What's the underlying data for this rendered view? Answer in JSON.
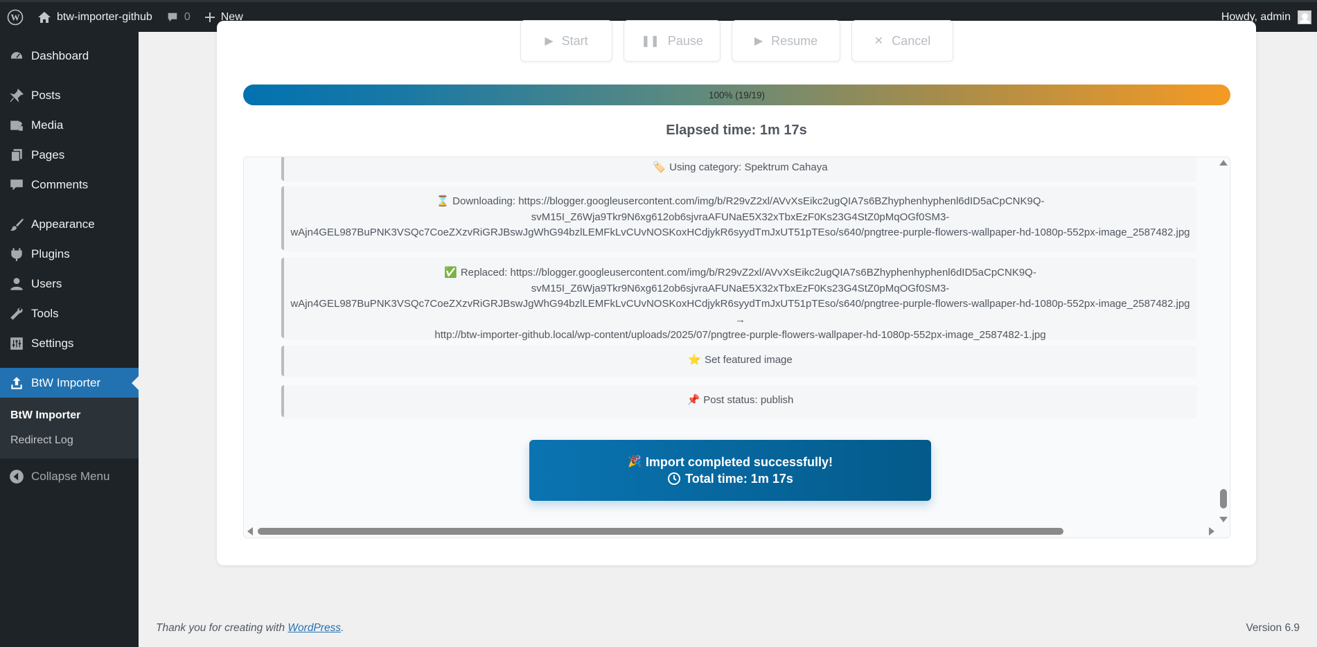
{
  "adminbar": {
    "site_name": "btw-importer-github",
    "comments_count": "0",
    "new_label": "New",
    "howdy": "Howdy, admin"
  },
  "sidebar": {
    "items": [
      {
        "label": "Dashboard",
        "icon": "dashboard-icon"
      },
      {
        "label": "Posts",
        "icon": "pushpin-icon"
      },
      {
        "label": "Media",
        "icon": "media-icon"
      },
      {
        "label": "Pages",
        "icon": "pages-icon"
      },
      {
        "label": "Comments",
        "icon": "comment-icon"
      },
      {
        "label": "Appearance",
        "icon": "paintbrush-icon"
      },
      {
        "label": "Plugins",
        "icon": "plugin-icon"
      },
      {
        "label": "Users",
        "icon": "user-icon"
      },
      {
        "label": "Tools",
        "icon": "wrench-icon"
      },
      {
        "label": "Settings",
        "icon": "settings-icon"
      },
      {
        "label": "BtW Importer",
        "icon": "upload-icon"
      }
    ],
    "submenu": [
      "BtW Importer",
      "Redirect Log"
    ],
    "collapse": "Collapse Menu"
  },
  "controls": {
    "start": "Start",
    "pause": "Pause",
    "resume": "Resume",
    "cancel": "Cancel"
  },
  "progress": {
    "label": "100% (19/19)",
    "value": 1.0
  },
  "elapsed": "Elapsed time: 1m 17s",
  "log": [
    {
      "emoji": "🏷️",
      "lines": [
        "Using category: Spektrum Cahaya"
      ]
    },
    {
      "emoji": "⌛",
      "lines": [
        "Downloading: https://blogger.googleusercontent.com/img/b/R29vZ2xl/AVvXsEikc2ugQIA7s6BZhyphenhyphenl6dID5aCpCNK9Q-",
        "svM15I_Z6Wja9Tkr9N6xg612ob6sjvraAFUNaE5X32xTbxEzF0Ks23G4StZ0pMqOGf0SM3-",
        "wAjn4GEL987BuPNK3VSQc7CoeZXzvRiGRJBswJgWhG94bzlLEMFkLvCUvNOSKoxHCdjykR6syydTmJxUT51pTEso/s640/pngtree-purple-flowers-wallpaper-hd-1080p-552px-image_2587482.jpg"
      ]
    },
    {
      "emoji": "✅",
      "lines": [
        "Replaced: https://blogger.googleusercontent.com/img/b/R29vZ2xl/AVvXsEikc2ugQIA7s6BZhyphenhyphenl6dID5aCpCNK9Q-",
        "svM15I_Z6Wja9Tkr9N6xg612ob6sjvraAFUNaE5X32xTbxEzF0Ks23G4StZ0pMqOGf0SM3-",
        "wAjn4GEL987BuPNK3VSQc7CoeZXzvRiGRJBswJgWhG94bzlLEMFkLvCUvNOSKoxHCdjykR6syydTmJxUT51pTEso/s640/pngtree-purple-flowers-wallpaper-hd-1080p-552px-image_2587482.jpg →",
        "http://btw-importer-github.local/wp-content/uploads/2025/07/pngtree-purple-flowers-wallpaper-hd-1080p-552px-image_2587482-1.jpg"
      ]
    },
    {
      "emoji": "⭐",
      "lines": [
        "Set featured image"
      ]
    },
    {
      "emoji": "📌",
      "lines": [
        "Post status: publish"
      ]
    }
  ],
  "done": {
    "emoji": "🎉",
    "line1": "Import completed successfully!",
    "line2": "Total time: 1m 17s"
  },
  "footer": {
    "thanks_prefix": "Thank you for creating with ",
    "wp_link": "WordPress",
    "thanks_suffix": ".",
    "version": "Version 6.9"
  },
  "colors": {
    "admin_bg": "#1d2327",
    "accent": "#2271b1",
    "progress_start": "#0272b0",
    "progress_end": "#f59a24"
  }
}
